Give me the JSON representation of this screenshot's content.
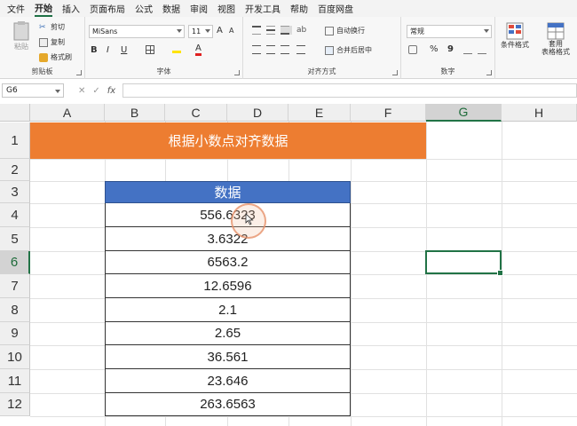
{
  "menu": {
    "items": [
      "文件",
      "开始",
      "插入",
      "页面布局",
      "公式",
      "数据",
      "审阅",
      "视图",
      "开发工具",
      "帮助",
      "百度网盘"
    ],
    "active_index": 1
  },
  "ribbon": {
    "clipboard": {
      "paste": "粘贴",
      "cut": "剪切",
      "copy": "复制",
      "format_painter": "格式刷",
      "label": "剪贴板"
    },
    "font": {
      "name": "MiSans",
      "size": "11",
      "bold": "B",
      "italic": "I",
      "underline": "U",
      "label": "字体",
      "font_color_glyph": "A",
      "grow": "A",
      "shrink": "A"
    },
    "alignment": {
      "wrap": "自动换行",
      "merge": "合并后居中",
      "label": "对齐方式"
    },
    "number": {
      "format": "常规",
      "percent": "%",
      "comma": "9",
      "label": "数字"
    },
    "styles": {
      "conditional": "条件格式",
      "table_format": "套用\n表格格式"
    }
  },
  "formula_bar": {
    "name_box": "G6",
    "fx": "fx",
    "cancel": "✕",
    "enter": "✓",
    "formula": ""
  },
  "columns": [
    "A",
    "B",
    "C",
    "D",
    "E",
    "F",
    "G",
    "H"
  ],
  "rows": [
    "1",
    "2",
    "3",
    "4",
    "5",
    "6",
    "7",
    "8",
    "9",
    "10",
    "11",
    "12"
  ],
  "selected": {
    "column": "G",
    "row": "6"
  },
  "sheet": {
    "title": "根据小数点对齐数据",
    "header": "数据",
    "values": [
      "556.6323",
      "3.6322",
      "6563.2",
      "12.6596",
      "2.1",
      "2.65",
      "36.561",
      "23.646",
      "263.6563"
    ]
  },
  "colors": {
    "banner": "#ed7d31",
    "header": "#4472c4",
    "accent": "#217346"
  }
}
